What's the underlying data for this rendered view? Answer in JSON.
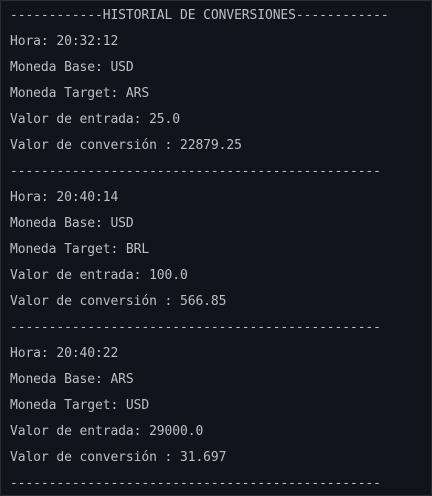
{
  "console": {
    "header": "------------HISTORIAL DE CONVERSIONES------------",
    "separator": "------------------------------------------------",
    "entries": [
      {
        "hora": "Hora: 20:32:12",
        "base": "Moneda Base: USD",
        "target": "Moneda Target: ARS",
        "entrada": "Valor de entrada: 25.0",
        "conversion": "Valor de conversión : 22879.25"
      },
      {
        "hora": "Hora: 20:40:14",
        "base": "Moneda Base: USD",
        "target": "Moneda Target: BRL",
        "entrada": "Valor de entrada: 100.0",
        "conversion": "Valor de conversión : 566.85"
      },
      {
        "hora": "Hora: 20:40:22",
        "base": "Moneda Base: ARS",
        "target": "Moneda Target: USD",
        "entrada": "Valor de entrada: 29000.0",
        "conversion": "Valor de conversión : 31.697"
      }
    ]
  }
}
